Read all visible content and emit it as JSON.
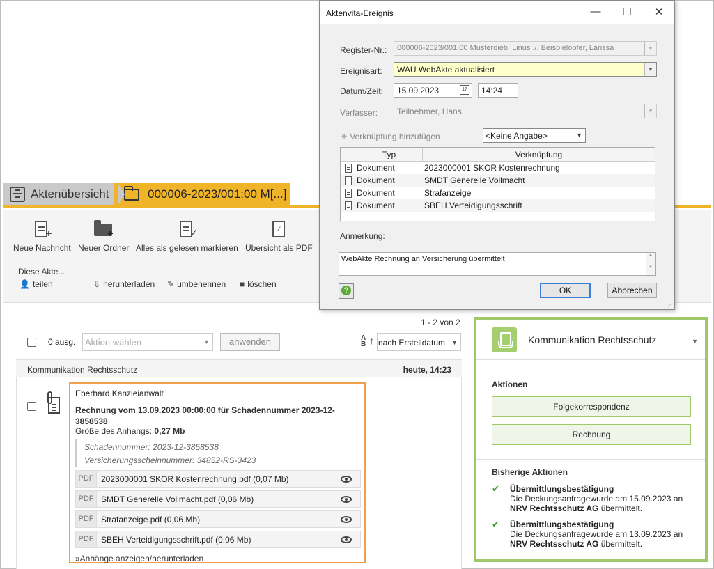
{
  "breadcrumb": {
    "home_label": "Aktenübersicht",
    "akte_label": "000006-2023/001:00 M[...]"
  },
  "toolbar": {
    "buttons": [
      {
        "label": "Neue Nachricht",
        "icon": "new-message-icon"
      },
      {
        "label": "Neuer Ordner",
        "icon": "new-folder-icon"
      },
      {
        "label": "Alles als gelesen markieren",
        "icon": "mark-read-icon"
      },
      {
        "label": "Übersicht als PDF",
        "icon": "pdf-icon"
      }
    ],
    "group_label": "Diese Akte...",
    "small_actions": [
      {
        "label": "teilen",
        "icon": "share-icon"
      },
      {
        "label": "herunterladen",
        "icon": "download-icon"
      },
      {
        "label": "umbenennen",
        "icon": "pencil-icon"
      },
      {
        "label": "löschen",
        "icon": "trash-icon"
      }
    ]
  },
  "list": {
    "count_label": "1 - 2 von 2",
    "selected_count": "0 ausg.",
    "action_placeholder": "Aktion wählen",
    "apply_label": "anwenden",
    "sort_label": "nach Erstelldatum",
    "group_header": "Kommunikation Rechtsschutz",
    "group_time": "heute, 14:23"
  },
  "message": {
    "sender": "Eberhard Kanzleianwalt",
    "subject": "Rechnung vom 13.09.2023 00:00:00 für Schadennummer 2023-12-3858538",
    "size_prefix": "Größe des Anhangs: ",
    "size_value": "0,27 Mb",
    "quote_line1": "Schadennummer: 2023-12-3858538",
    "quote_line2": "Versicherungsscheinnummer: 34852-RS-3423",
    "attachments": [
      {
        "type": "PDF",
        "name": "2023000001 SKOR Kostenrechnung.pdf (0,07 Mb)"
      },
      {
        "type": "PDF",
        "name": "SMDT Generelle Vollmacht.pdf (0,06 Mb)"
      },
      {
        "type": "PDF",
        "name": "Strafanzeige.pdf (0,06 Mb)"
      },
      {
        "type": "PDF",
        "name": "SBEH Verteidigungsschrift.pdf (0,06 Mb)"
      }
    ],
    "more_link": "»Anhänge anzeigen/herunterladen"
  },
  "right_panel": {
    "title": "Kommunikation Rechtsschutz",
    "actions_title": "Aktionen",
    "action_buttons": [
      "Folgekorrespondenz",
      "Rechnung"
    ],
    "history_title": "Bisherige Aktionen",
    "history": [
      {
        "title": "Übermittlungsbestätigung",
        "line": "Die Deckungsanfragewurde am 15.09.2023 an",
        "org": "NRV Rechtsschutz AG",
        "suffix": " übermittelt."
      },
      {
        "title": "Übermittlungsbestätigung",
        "line": "Die Deckungsanfragewurde am 13.09.2023 an",
        "org": "NRV Rechtsschutz AG",
        "suffix": " übermittelt."
      }
    ]
  },
  "dialog": {
    "title": "Aktenvita-Ereignis",
    "register_label": "Register-Nr.:",
    "register_value": "000006-2023/001:00  Musterdieb, Linus ./. Beispielopfer, Larissa",
    "ereignis_label": "Ereignisart:",
    "ereignis_value": "WAU  WebAkte aktualisiert",
    "datum_label": "Datum/Zeit:",
    "datum_value": "15.09.2023",
    "zeit_value": "14:24",
    "verfasser_label": "Verfasser:",
    "verfasser_value": "Teilnehmer, Hans",
    "add_link": "Verknüpfung hinzufügen",
    "keine_value": "<Keine Angabe>",
    "col_typ": "Typ",
    "col_verknuepfung": "Verknüpfung",
    "rows": [
      {
        "typ": "Dokument",
        "verknuepfung": "2023000001 SKOR Kostenrechnung"
      },
      {
        "typ": "Dokument",
        "verknuepfung": "SMDT Generelle Vollmacht"
      },
      {
        "typ": "Dokument",
        "verknuepfung": "Strafanzeige"
      },
      {
        "typ": "Dokument",
        "verknuepfung": "SBEH Verteidigungsschrift"
      }
    ],
    "anmerkung_label": "Anmerkung:",
    "anmerkung_value": "WebAkte Rechnung an Versicherung übermittelt",
    "ok_label": "OK",
    "cancel_label": "Abbrechen"
  },
  "colors": {
    "accent_yellow": "#f0b429",
    "accent_green": "#9ec96a",
    "highlight_orange": "#f0a04b"
  }
}
